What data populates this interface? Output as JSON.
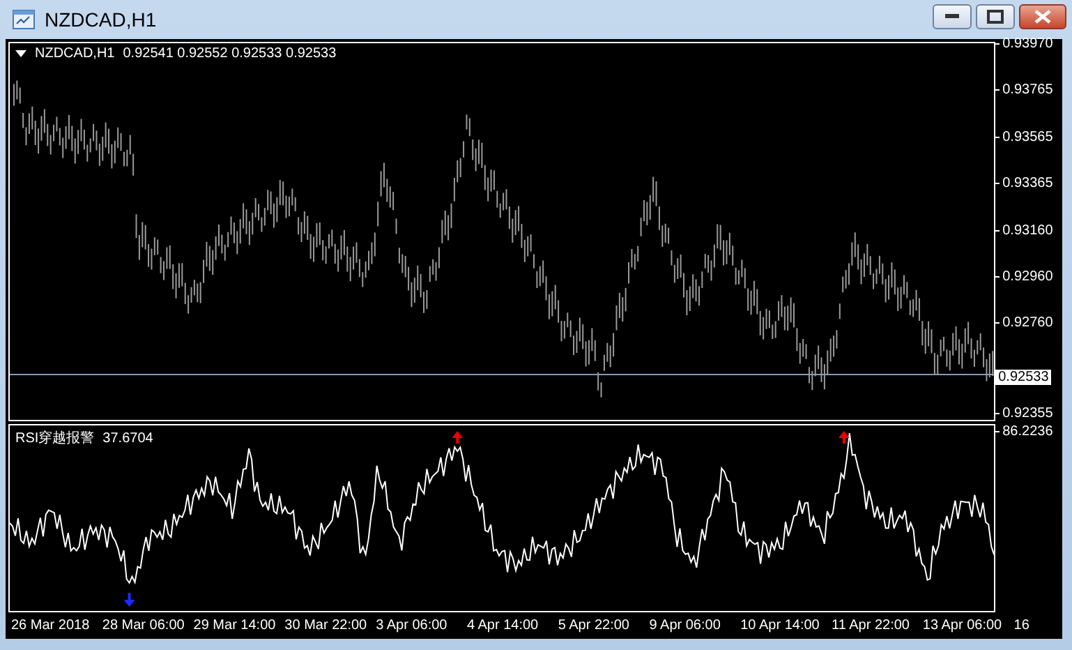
{
  "window": {
    "title": "NZDCAD,H1"
  },
  "main_chart": {
    "symbol": "NZDCAD,H1",
    "ohlc": "0.92541 0.92552 0.92533 0.92533",
    "price_axis": [
      "0.93970",
      "0.93765",
      "0.93565",
      "0.93365",
      "0.93160",
      "0.92960",
      "0.92760"
    ],
    "bottom_price": "0.92355",
    "current_price": "0.92533"
  },
  "indicator": {
    "name": "RSI穿越报警",
    "value": "37.6704",
    "axis_label": "86.2236"
  },
  "time_axis": [
    "26 Mar 2018",
    "28 Mar 06:00",
    "29 Mar 14:00",
    "30 Mar 22:00",
    "3 Apr 06:00",
    "4 Apr 14:00",
    "5 Apr 22:00",
    "9 Apr 06:00",
    "10 Apr 14:00",
    "11 Apr 22:00",
    "13 Apr 06:00",
    "16"
  ]
}
